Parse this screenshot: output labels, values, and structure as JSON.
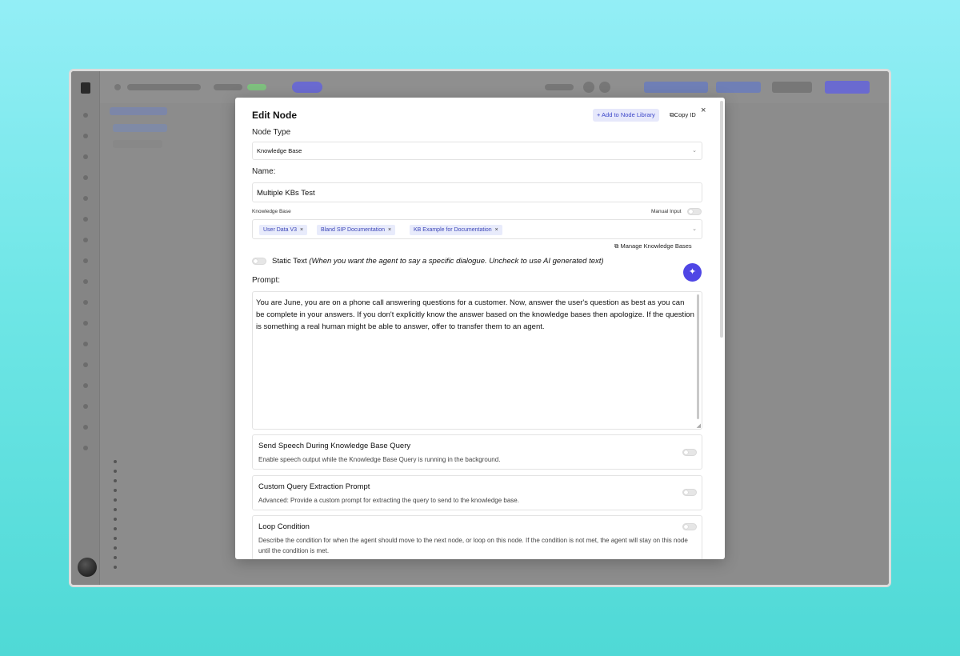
{
  "modal": {
    "title": "Edit Node",
    "add_to_library": "+ Add to Node Library",
    "copy_id_icon": "⧉",
    "copy_id": "Copy ID",
    "close": "×",
    "node_type_label": "Node Type",
    "node_type_value": "Knowledge Base",
    "name_label": "Name:",
    "name_value": "Multiple KBs Test",
    "kb_label": "Knowledge Base",
    "manual_input_label": "Manual Input",
    "kb_chips": [
      "User Data V3",
      "Bland SIP Documentation",
      "KB Example for Documentation"
    ],
    "chip_remove": "×",
    "manage_kb": "Manage Knowledge Bases",
    "manage_kb_icon": "⧉",
    "static_text_label": "Static Text",
    "static_text_hint": "(When you want the agent to say a specific dialogue. Uncheck to use AI generated text)",
    "prompt_label": "Prompt:",
    "prompt_value": "You are June, you are on a phone call answering questions for a customer. Now, answer the user's question as best as you can be complete in your answers. If you don't explicitly know the answer based on the knowledge bases then apologize. If the question is something a real human might be able to answer, offer to transfer them to an agent.",
    "options": [
      {
        "title": "Send Speech During Knowledge Base Query",
        "desc": "Enable speech output while the Knowledge Base Query is running in the background."
      },
      {
        "title": "Custom Query Extraction Prompt",
        "desc": "Advanced: Provide a custom prompt for extracting the query to send to the knowledge base."
      },
      {
        "title": "Loop Condition",
        "desc": "Describe the condition for when the agent should move to the next node, or loop on this node. If the condition is not met, the agent will stay on this node until the condition is met."
      }
    ],
    "icons": {
      "magic": "sparkle-icon",
      "chevron": "chevron-down-icon",
      "external": "external-link-icon"
    }
  },
  "colors": {
    "accent": "#4f46e5",
    "chip_bg": "#e8ebfb",
    "chip_text": "#3c46b8",
    "background_top": "#93eef6",
    "background_bottom": "#4fd9d6"
  }
}
